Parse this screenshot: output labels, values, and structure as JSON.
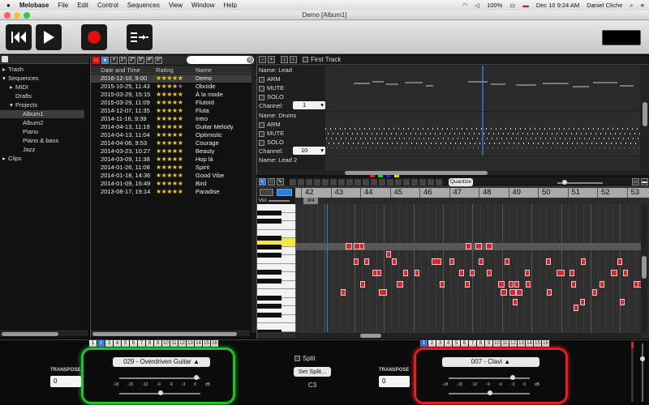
{
  "menubar": {
    "app": "Melobase",
    "items": [
      "File",
      "Edit",
      "Control",
      "Sequences",
      "View",
      "Window",
      "Help"
    ],
    "battery": "100%",
    "datetime": "Dec 10  9:24 AM",
    "user": "Daniel Cliche"
  },
  "window": {
    "title": "Demo [Album1]"
  },
  "tree": {
    "items": [
      {
        "label": "Trash",
        "indent": 0,
        "arrow": "▸"
      },
      {
        "label": "Sequences",
        "indent": 0,
        "arrow": "▾"
      },
      {
        "label": "MIDI",
        "indent": 1,
        "arrow": "▸"
      },
      {
        "label": "Drafts",
        "indent": 1,
        "arrow": ""
      },
      {
        "label": "Projects",
        "indent": 1,
        "arrow": "▾"
      },
      {
        "label": "Album1",
        "indent": 2,
        "arrow": "",
        "selected": true
      },
      {
        "label": "Album2",
        "indent": 2,
        "arrow": ""
      },
      {
        "label": "Piano",
        "indent": 2,
        "arrow": ""
      },
      {
        "label": "Piano & bass",
        "indent": 2,
        "arrow": ""
      },
      {
        "label": "Jazz",
        "indent": 2,
        "arrow": ""
      },
      {
        "label": "Clips",
        "indent": 0,
        "arrow": "▸"
      }
    ]
  },
  "songlist": {
    "filters": [
      "★",
      "+",
      "1*",
      "2*",
      "3*",
      "4*",
      "5*"
    ],
    "columns": {
      "date": "Date and Time",
      "rating": "Rating",
      "name": "Name"
    },
    "rows": [
      {
        "date": "2016-12-10, 9:00",
        "rating": 5,
        "name": "Demo",
        "selected": true
      },
      {
        "date": "2015-10-25, 11:43",
        "rating": 4,
        "name": "Oboïde"
      },
      {
        "date": "2015-03-29, 15:15",
        "rating": 5,
        "name": "À la mode"
      },
      {
        "date": "2015-03-29, 11:09",
        "rating": 5,
        "name": "Flutoïd"
      },
      {
        "date": "2014-12-07, 11:35",
        "rating": 5,
        "name": "Fluta"
      },
      {
        "date": "2014-11-16, 9:39",
        "rating": 5,
        "name": "Intro"
      },
      {
        "date": "2014-04-13, 11:18",
        "rating": 5,
        "name": "Guitar Melody"
      },
      {
        "date": "2014-04-13, 11:04",
        "rating": 5,
        "name": "Optimistic"
      },
      {
        "date": "2014-04-06, 9:53",
        "rating": 5,
        "name": "Courage"
      },
      {
        "date": "2014-03-23, 10:27",
        "rating": 5,
        "name": "Beauty"
      },
      {
        "date": "2014-03-09, 11:38",
        "rating": 5,
        "name": "Hop là"
      },
      {
        "date": "2014-01-26, 11:08",
        "rating": 5,
        "name": "Spirit"
      },
      {
        "date": "2014-01-18, 14:36",
        "rating": 5,
        "name": "Good Vibe"
      },
      {
        "date": "2014-01-09, 16:49",
        "rating": 5,
        "name": "Bird"
      },
      {
        "date": "2013-08-17, 19:14",
        "rating": 5,
        "name": "Paradise"
      }
    ]
  },
  "tracks": {
    "first_track_label": "First Track",
    "list": [
      {
        "name_label": "Name:",
        "name": "Lead",
        "arm": "ARM",
        "mute": "MUTE",
        "solo": "SOLO",
        "channel_label": "Channel:",
        "channel": "1"
      },
      {
        "name_label": "Name:",
        "name": "Drums",
        "arm": "ARM",
        "mute": "MUTE",
        "solo": "SOLO",
        "channel_label": "Channel:",
        "channel": "10"
      },
      {
        "name_label": "Name:",
        "name": "Lead 2"
      }
    ]
  },
  "roll": {
    "quantize": "Quantize",
    "vel_label": "Vel.",
    "left_val": "3/4",
    "ruler": [
      "42",
      "43",
      "44",
      "45",
      "46",
      "47",
      "48",
      "49",
      "50",
      "51",
      "52",
      "53"
    ]
  },
  "bottom": {
    "channels": [
      "1",
      "2",
      "3",
      "4",
      "5",
      "6",
      "7",
      "8",
      "9",
      "10",
      "11",
      "12",
      "13",
      "14",
      "15",
      "16"
    ],
    "left": {
      "active_channel": "2",
      "instrument": "029 - Overdriven Guitar",
      "transpose_label": "TRANSPOSE",
      "transpose": "0",
      "scale": [
        "-18",
        "-15",
        "-12",
        "-9",
        "-6",
        "-3",
        "0",
        "dB"
      ]
    },
    "right": {
      "active_channel": "1",
      "instrument": "007 - Clavi",
      "transpose_label": "TRANSPOSE",
      "transpose": "0",
      "scale": [
        "-18",
        "-15",
        "-12",
        "-9",
        "-6",
        "-3",
        "0",
        "dB"
      ]
    },
    "split_label": "Split",
    "set_split": "Set Split...",
    "split_note": "C3"
  },
  "colors": {
    "accent_blue": "#2a7de0",
    "record_red": "#e01010",
    "left_glow": "#22c02a",
    "right_glow": "#e02020",
    "note": "#d02a30",
    "star": "#f3c623"
  }
}
